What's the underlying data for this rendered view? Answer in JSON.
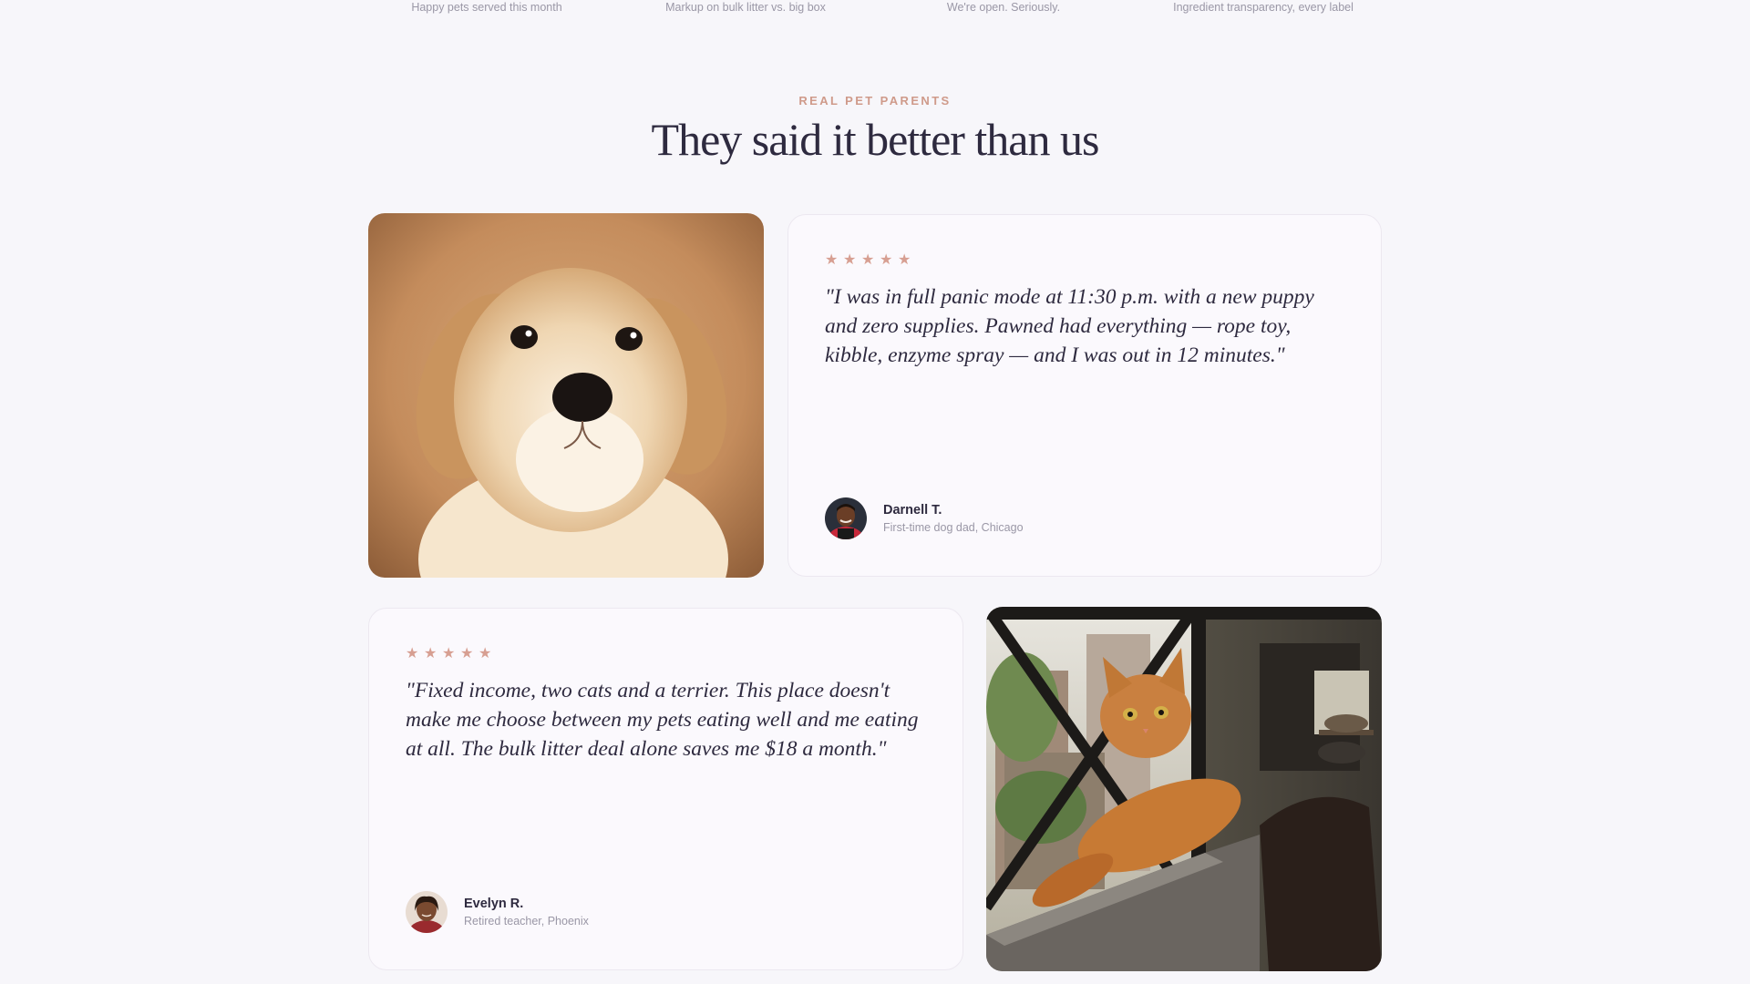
{
  "stats": {
    "captions": [
      "Happy pets served this month",
      "Markup on bulk litter vs. big box",
      "We're open. Seriously.",
      "Ingredient transparency, every label"
    ]
  },
  "testimonials_section": {
    "eyebrow": "REAL PET PARENTS",
    "title": "They said it better than us",
    "star_color": "#d79f92",
    "cards": [
      {
        "rating": 5,
        "quote": "\"I was in full panic mode at 11:30 p.m. with a new puppy and zero supplies. Pawned had everything — rope toy, kibble, enzyme spray — and I was out in 12 minutes.\"",
        "name": "Darnell T.",
        "role": "First-time dog dad, Chicago",
        "photo_icon": "puppy-photo"
      },
      {
        "rating": 5,
        "quote": "\"Fixed income, two cats and a terrier. This place doesn't make me choose between my pets eating well and me eating at all. The bulk litter deal alone saves me $18 a month.\"",
        "name": "Evelyn R.",
        "role": "Retired teacher, Phoenix",
        "photo_icon": "cat-photo"
      }
    ]
  }
}
